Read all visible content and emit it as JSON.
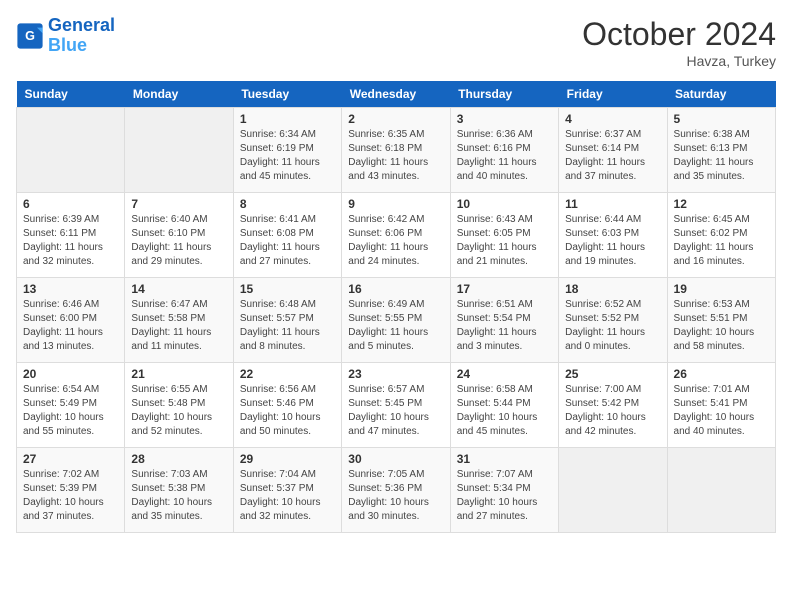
{
  "header": {
    "logo_line1": "General",
    "logo_line2": "Blue",
    "month_title": "October 2024",
    "location": "Havza, Turkey"
  },
  "days_of_week": [
    "Sunday",
    "Monday",
    "Tuesday",
    "Wednesday",
    "Thursday",
    "Friday",
    "Saturday"
  ],
  "weeks": [
    [
      {
        "day": "",
        "info": ""
      },
      {
        "day": "",
        "info": ""
      },
      {
        "day": "1",
        "info": "Sunrise: 6:34 AM\nSunset: 6:19 PM\nDaylight: 11 hours and 45 minutes."
      },
      {
        "day": "2",
        "info": "Sunrise: 6:35 AM\nSunset: 6:18 PM\nDaylight: 11 hours and 43 minutes."
      },
      {
        "day": "3",
        "info": "Sunrise: 6:36 AM\nSunset: 6:16 PM\nDaylight: 11 hours and 40 minutes."
      },
      {
        "day": "4",
        "info": "Sunrise: 6:37 AM\nSunset: 6:14 PM\nDaylight: 11 hours and 37 minutes."
      },
      {
        "day": "5",
        "info": "Sunrise: 6:38 AM\nSunset: 6:13 PM\nDaylight: 11 hours and 35 minutes."
      }
    ],
    [
      {
        "day": "6",
        "info": "Sunrise: 6:39 AM\nSunset: 6:11 PM\nDaylight: 11 hours and 32 minutes."
      },
      {
        "day": "7",
        "info": "Sunrise: 6:40 AM\nSunset: 6:10 PM\nDaylight: 11 hours and 29 minutes."
      },
      {
        "day": "8",
        "info": "Sunrise: 6:41 AM\nSunset: 6:08 PM\nDaylight: 11 hours and 27 minutes."
      },
      {
        "day": "9",
        "info": "Sunrise: 6:42 AM\nSunset: 6:06 PM\nDaylight: 11 hours and 24 minutes."
      },
      {
        "day": "10",
        "info": "Sunrise: 6:43 AM\nSunset: 6:05 PM\nDaylight: 11 hours and 21 minutes."
      },
      {
        "day": "11",
        "info": "Sunrise: 6:44 AM\nSunset: 6:03 PM\nDaylight: 11 hours and 19 minutes."
      },
      {
        "day": "12",
        "info": "Sunrise: 6:45 AM\nSunset: 6:02 PM\nDaylight: 11 hours and 16 minutes."
      }
    ],
    [
      {
        "day": "13",
        "info": "Sunrise: 6:46 AM\nSunset: 6:00 PM\nDaylight: 11 hours and 13 minutes."
      },
      {
        "day": "14",
        "info": "Sunrise: 6:47 AM\nSunset: 5:58 PM\nDaylight: 11 hours and 11 minutes."
      },
      {
        "day": "15",
        "info": "Sunrise: 6:48 AM\nSunset: 5:57 PM\nDaylight: 11 hours and 8 minutes."
      },
      {
        "day": "16",
        "info": "Sunrise: 6:49 AM\nSunset: 5:55 PM\nDaylight: 11 hours and 5 minutes."
      },
      {
        "day": "17",
        "info": "Sunrise: 6:51 AM\nSunset: 5:54 PM\nDaylight: 11 hours and 3 minutes."
      },
      {
        "day": "18",
        "info": "Sunrise: 6:52 AM\nSunset: 5:52 PM\nDaylight: 11 hours and 0 minutes."
      },
      {
        "day": "19",
        "info": "Sunrise: 6:53 AM\nSunset: 5:51 PM\nDaylight: 10 hours and 58 minutes."
      }
    ],
    [
      {
        "day": "20",
        "info": "Sunrise: 6:54 AM\nSunset: 5:49 PM\nDaylight: 10 hours and 55 minutes."
      },
      {
        "day": "21",
        "info": "Sunrise: 6:55 AM\nSunset: 5:48 PM\nDaylight: 10 hours and 52 minutes."
      },
      {
        "day": "22",
        "info": "Sunrise: 6:56 AM\nSunset: 5:46 PM\nDaylight: 10 hours and 50 minutes."
      },
      {
        "day": "23",
        "info": "Sunrise: 6:57 AM\nSunset: 5:45 PM\nDaylight: 10 hours and 47 minutes."
      },
      {
        "day": "24",
        "info": "Sunrise: 6:58 AM\nSunset: 5:44 PM\nDaylight: 10 hours and 45 minutes."
      },
      {
        "day": "25",
        "info": "Sunrise: 7:00 AM\nSunset: 5:42 PM\nDaylight: 10 hours and 42 minutes."
      },
      {
        "day": "26",
        "info": "Sunrise: 7:01 AM\nSunset: 5:41 PM\nDaylight: 10 hours and 40 minutes."
      }
    ],
    [
      {
        "day": "27",
        "info": "Sunrise: 7:02 AM\nSunset: 5:39 PM\nDaylight: 10 hours and 37 minutes."
      },
      {
        "day": "28",
        "info": "Sunrise: 7:03 AM\nSunset: 5:38 PM\nDaylight: 10 hours and 35 minutes."
      },
      {
        "day": "29",
        "info": "Sunrise: 7:04 AM\nSunset: 5:37 PM\nDaylight: 10 hours and 32 minutes."
      },
      {
        "day": "30",
        "info": "Sunrise: 7:05 AM\nSunset: 5:36 PM\nDaylight: 10 hours and 30 minutes."
      },
      {
        "day": "31",
        "info": "Sunrise: 7:07 AM\nSunset: 5:34 PM\nDaylight: 10 hours and 27 minutes."
      },
      {
        "day": "",
        "info": ""
      },
      {
        "day": "",
        "info": ""
      }
    ]
  ]
}
